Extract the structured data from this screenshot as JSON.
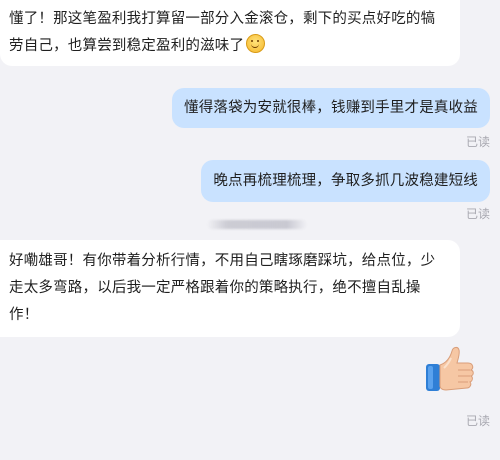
{
  "messages": [
    {
      "direction": "incoming",
      "text": "懂了！那这笔盈利我打算留一部分入金滚仓，剩下的买点好吃的犒劳自己，也算尝到稳定盈利的滋味了",
      "emoji": "smile-emoji"
    },
    {
      "direction": "outgoing",
      "text": "懂得落袋为安就很棒，钱赚到手里才是真收益",
      "status": "已读"
    },
    {
      "direction": "outgoing",
      "text": "晚点再梳理梳理，争取多抓几波稳建短线",
      "status": "已读"
    },
    {
      "direction": "incoming",
      "text": "好嘞雄哥！有你带着分析行情，不用自己瞎琢磨踩坑，给点位，少走太多弯路，以后我一定严格跟着你的策略执行，绝不擅自乱操作！"
    },
    {
      "direction": "outgoing",
      "sticker": "thumbs-up-icon",
      "status": "已读"
    }
  ],
  "colors": {
    "background": "#f2f2f6",
    "incoming_bubble": "#ffffff",
    "outgoing_bubble": "#c9e2ff",
    "read_status": "#a8a8b0"
  }
}
